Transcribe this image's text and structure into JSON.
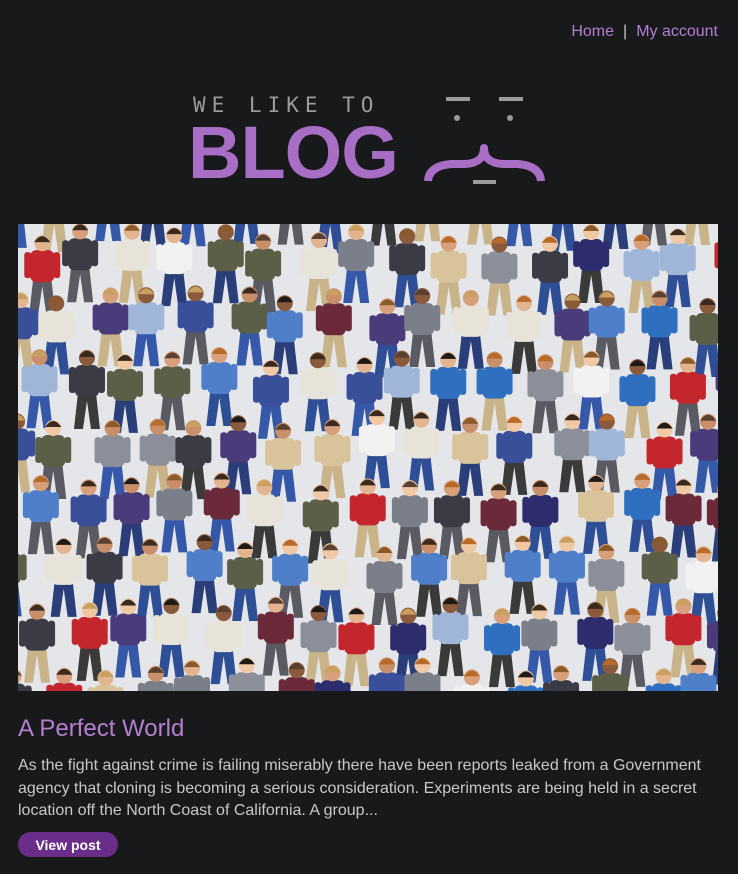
{
  "nav": {
    "home_label": "Home",
    "separator": "|",
    "account_label": "My account"
  },
  "logo": {
    "tagline": "WE LIKE TO",
    "word": "BLOG",
    "brand_color": "#a86ec6"
  },
  "post": {
    "title": "A Perfect World",
    "summary": "As the fight against crime is failing miserably there have been reports leaked from a Government agency that cloning is becoming a serious consideration. Experiments are being held in a secret location off the North Coast of California. A group...",
    "button_label": "View post"
  },
  "colors": {
    "background": "#18191b",
    "accent": "#b57ed0",
    "button": "#6a2d8a",
    "body_text": "#c8c8c8"
  }
}
